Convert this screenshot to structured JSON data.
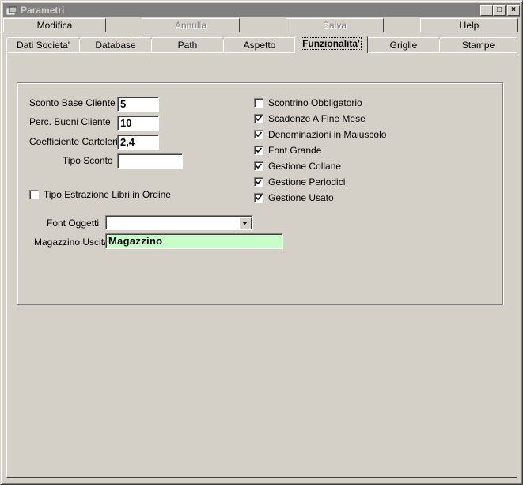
{
  "window": {
    "title": "Parametri",
    "min_glyph": "_",
    "max_glyph": "□",
    "close_glyph": "×"
  },
  "toolbar": {
    "modifica": "Modifica",
    "annulla": "Annulla",
    "salva": "Salva",
    "help": "Help"
  },
  "tabs": [
    {
      "label": "Dati Societa'"
    },
    {
      "label": "Database"
    },
    {
      "label": "Path"
    },
    {
      "label": "Aspetto"
    },
    {
      "label": "Funzionalita'"
    },
    {
      "label": "Griglie"
    },
    {
      "label": "Stampe"
    }
  ],
  "active_tab": "Funzionalita'",
  "form": {
    "sconto_base_label": "Sconto Base Cliente",
    "sconto_base_value": "5",
    "perc_buoni_label": "Perc. Buoni Cliente",
    "perc_buoni_value": "10",
    "coeff_cartoleria_label": "Coefficiente Cartoleria",
    "coeff_cartoleria_value": "2,4",
    "tipo_sconto_label": "Tipo Sconto",
    "tipo_sconto_value": "",
    "tipo_estrazione_label": "Tipo Estrazione Libri in Ordine",
    "tipo_estrazione_checked": false,
    "font_oggetti_label": "Font Oggetti",
    "font_oggetti_value": "",
    "magazzino_uscita_label": "Magazzino Uscita",
    "magazzino_uscita_value": "Magazzino",
    "magazzino_uscita_bg": "#c8ffc8"
  },
  "options": [
    {
      "label": "Scontrino Obbligatorio",
      "checked": false
    },
    {
      "label": "Scadenze A Fine Mese",
      "checked": true
    },
    {
      "label": "Denominazioni in Maiuscolo",
      "checked": true
    },
    {
      "label": "Font Grande",
      "checked": true
    },
    {
      "label": "Gestione Collane",
      "checked": true
    },
    {
      "label": "Gestione Periodici",
      "checked": true
    },
    {
      "label": "Gestione Usato",
      "checked": true
    }
  ],
  "colors": {
    "face": "#d4d0c8",
    "title_inactive": "#808080",
    "disabled_text": "#808080"
  }
}
